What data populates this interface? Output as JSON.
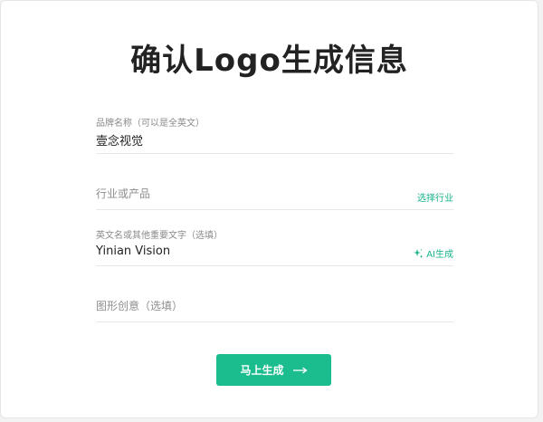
{
  "page": {
    "title": "确认Logo生成信息"
  },
  "fields": {
    "brand": {
      "label": "品牌名称（可以是全英文）",
      "value": "壹念视觉"
    },
    "industry": {
      "placeholder": "行业或产品",
      "action_label": "选择行业"
    },
    "english_text": {
      "label": "英文名或其他重要文字（选填）",
      "value": "Yinian Vision",
      "action_label": "AI生成",
      "action_icon": "sparkle-icon"
    },
    "graphic_idea": {
      "placeholder": "图形创意（选填）"
    }
  },
  "submit": {
    "label": "马上生成",
    "icon": "arrow-right-icon"
  },
  "colors": {
    "accent": "#1bbd8f",
    "link": "#18b48a",
    "title": "#222222"
  }
}
